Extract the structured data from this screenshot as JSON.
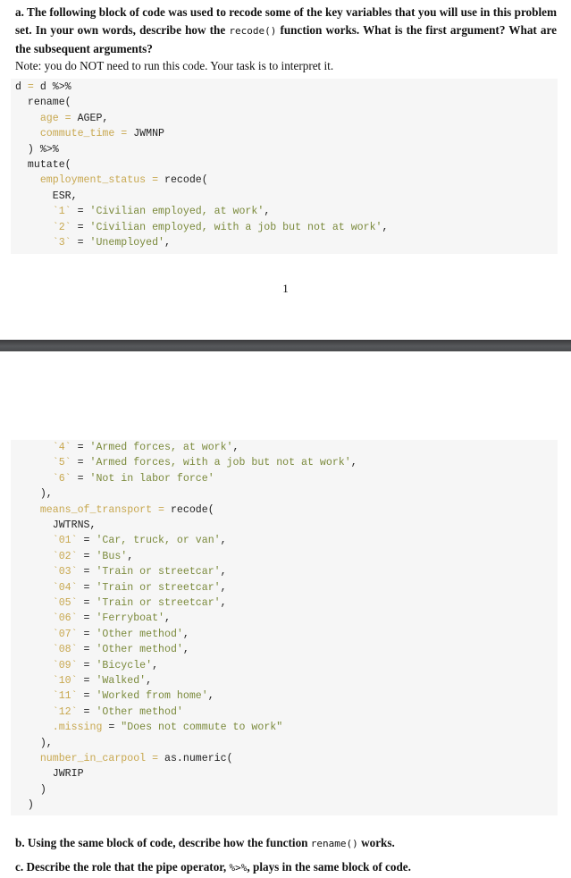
{
  "question_a": {
    "prefix": "a. The following block of code was used to recode some of the key variables that you will use in this problem set. In your own words, describe how the ",
    "code": "recode()",
    "suffix": " function works. What is the first argument? What are the subsequent arguments?"
  },
  "note": "Note: you do NOT need to run this code. Your task is to interpret it.",
  "page_number": "1",
  "code_page1": [
    [
      {
        "t": "d "
      },
      {
        "t": "=",
        "c": "op"
      },
      {
        "t": " d %>%"
      }
    ],
    [
      {
        "t": "  rename("
      }
    ],
    [
      {
        "t": "    "
      },
      {
        "t": "age",
        "c": "id"
      },
      {
        "t": " = ",
        "c": "op"
      },
      {
        "t": "AGEP,"
      }
    ],
    [
      {
        "t": "    "
      },
      {
        "t": "commute_time",
        "c": "id"
      },
      {
        "t": " = ",
        "c": "op"
      },
      {
        "t": "JWMNP"
      }
    ],
    [
      {
        "t": "  ) %>%"
      }
    ],
    [
      {
        "t": "  mutate("
      }
    ],
    [
      {
        "t": "    "
      },
      {
        "t": "employment_status",
        "c": "id"
      },
      {
        "t": " = ",
        "c": "op"
      },
      {
        "t": "recode("
      }
    ],
    [
      {
        "t": "      ESR,"
      }
    ],
    [
      {
        "t": "      "
      },
      {
        "t": "`1`",
        "c": "id"
      },
      {
        "t": " = "
      },
      {
        "t": "'Civilian employed, at work'",
        "c": "str"
      },
      {
        "t": ","
      }
    ],
    [
      {
        "t": "      "
      },
      {
        "t": "`2`",
        "c": "id"
      },
      {
        "t": " = "
      },
      {
        "t": "'Civilian employed, with a job but not at work'",
        "c": "str"
      },
      {
        "t": ","
      }
    ],
    [
      {
        "t": "      "
      },
      {
        "t": "`3`",
        "c": "id"
      },
      {
        "t": " = "
      },
      {
        "t": "'Unemployed'",
        "c": "str"
      },
      {
        "t": ","
      }
    ]
  ],
  "code_page2": [
    [
      {
        "t": "      "
      },
      {
        "t": "`4`",
        "c": "id"
      },
      {
        "t": " = "
      },
      {
        "t": "'Armed forces, at work'",
        "c": "str"
      },
      {
        "t": ","
      }
    ],
    [
      {
        "t": "      "
      },
      {
        "t": "`5`",
        "c": "id"
      },
      {
        "t": " = "
      },
      {
        "t": "'Armed forces, with a job but not at work'",
        "c": "str"
      },
      {
        "t": ","
      }
    ],
    [
      {
        "t": "      "
      },
      {
        "t": "`6`",
        "c": "id"
      },
      {
        "t": " = "
      },
      {
        "t": "'Not in labor force'",
        "c": "str"
      }
    ],
    [
      {
        "t": "    ),"
      }
    ],
    [
      {
        "t": "    "
      },
      {
        "t": "means_of_transport",
        "c": "id"
      },
      {
        "t": " = ",
        "c": "op"
      },
      {
        "t": "recode("
      }
    ],
    [
      {
        "t": "      JWTRNS,"
      }
    ],
    [
      {
        "t": "      "
      },
      {
        "t": "`01`",
        "c": "id"
      },
      {
        "t": " = "
      },
      {
        "t": "'Car, truck, or van'",
        "c": "str"
      },
      {
        "t": ","
      }
    ],
    [
      {
        "t": "      "
      },
      {
        "t": "`02`",
        "c": "id"
      },
      {
        "t": " = "
      },
      {
        "t": "'Bus'",
        "c": "str"
      },
      {
        "t": ","
      }
    ],
    [
      {
        "t": "      "
      },
      {
        "t": "`03`",
        "c": "id"
      },
      {
        "t": " = "
      },
      {
        "t": "'Train or streetcar'",
        "c": "str"
      },
      {
        "t": ","
      }
    ],
    [
      {
        "t": "      "
      },
      {
        "t": "`04`",
        "c": "id"
      },
      {
        "t": " = "
      },
      {
        "t": "'Train or streetcar'",
        "c": "str"
      },
      {
        "t": ","
      }
    ],
    [
      {
        "t": "      "
      },
      {
        "t": "`05`",
        "c": "id"
      },
      {
        "t": " = "
      },
      {
        "t": "'Train or streetcar'",
        "c": "str"
      },
      {
        "t": ","
      }
    ],
    [
      {
        "t": "      "
      },
      {
        "t": "`06`",
        "c": "id"
      },
      {
        "t": " = "
      },
      {
        "t": "'Ferryboat'",
        "c": "str"
      },
      {
        "t": ","
      }
    ],
    [
      {
        "t": "      "
      },
      {
        "t": "`07`",
        "c": "id"
      },
      {
        "t": " = "
      },
      {
        "t": "'Other method'",
        "c": "str"
      },
      {
        "t": ","
      }
    ],
    [
      {
        "t": "      "
      },
      {
        "t": "`08`",
        "c": "id"
      },
      {
        "t": " = "
      },
      {
        "t": "'Other method'",
        "c": "str"
      },
      {
        "t": ","
      }
    ],
    [
      {
        "t": "      "
      },
      {
        "t": "`09`",
        "c": "id"
      },
      {
        "t": " = "
      },
      {
        "t": "'Bicycle'",
        "c": "str"
      },
      {
        "t": ","
      }
    ],
    [
      {
        "t": "      "
      },
      {
        "t": "`10`",
        "c": "id"
      },
      {
        "t": " = "
      },
      {
        "t": "'Walked'",
        "c": "str"
      },
      {
        "t": ","
      }
    ],
    [
      {
        "t": "      "
      },
      {
        "t": "`11`",
        "c": "id"
      },
      {
        "t": " = "
      },
      {
        "t": "'Worked from home'",
        "c": "str"
      },
      {
        "t": ","
      }
    ],
    [
      {
        "t": "      "
      },
      {
        "t": "`12`",
        "c": "id"
      },
      {
        "t": " = "
      },
      {
        "t": "'Other method'",
        "c": "str"
      }
    ],
    [
      {
        "t": "      "
      },
      {
        "t": ".missing",
        "c": "id"
      },
      {
        "t": " = "
      },
      {
        "t": "\"Does not commute to work\"",
        "c": "str"
      }
    ],
    [
      {
        "t": "    ),"
      }
    ],
    [
      {
        "t": "    "
      },
      {
        "t": "number_in_carpool",
        "c": "id"
      },
      {
        "t": " = ",
        "c": "op"
      },
      {
        "t": "as.numeric("
      }
    ],
    [
      {
        "t": "      JWRIP"
      }
    ],
    [
      {
        "t": "    )"
      }
    ],
    [
      {
        "t": "  )"
      }
    ]
  ],
  "question_b": {
    "prefix": "b. Using the same block of code, describe how the function ",
    "code": "rename()",
    "suffix": " works."
  },
  "question_c": {
    "prefix": "c. Describe the role that the pipe operator, ",
    "code": "%>%",
    "suffix": ", plays in the same block of code."
  }
}
